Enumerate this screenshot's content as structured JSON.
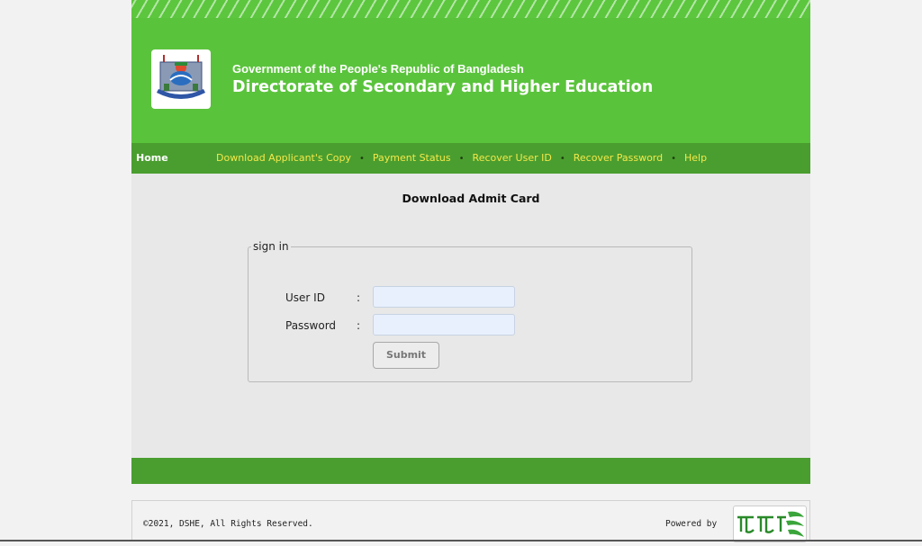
{
  "header": {
    "government": "Government of the People's Republic of Bangladesh",
    "directorate": "Directorate of Secondary and Higher Education"
  },
  "nav": {
    "home": "Home",
    "links": [
      "Download Applicant's Copy",
      "Payment Status",
      "Recover User ID",
      "Recover Password",
      "Help"
    ]
  },
  "content": {
    "title": "Download Admit Card",
    "form": {
      "legend": "sign in",
      "user_id_label": "User ID",
      "password_label": "Password",
      "colon": ":",
      "user_id_value": "",
      "password_value": "",
      "submit_label": "Submit"
    }
  },
  "footer": {
    "copyright": "©2021, DSHE, All Rights Reserved.",
    "powered_by": "Powered by"
  },
  "colors": {
    "header_green": "#5ac33c",
    "nav_green": "#4a9e2f",
    "nav_link": "#f4e84a",
    "input_bg": "#e8f0fe"
  }
}
